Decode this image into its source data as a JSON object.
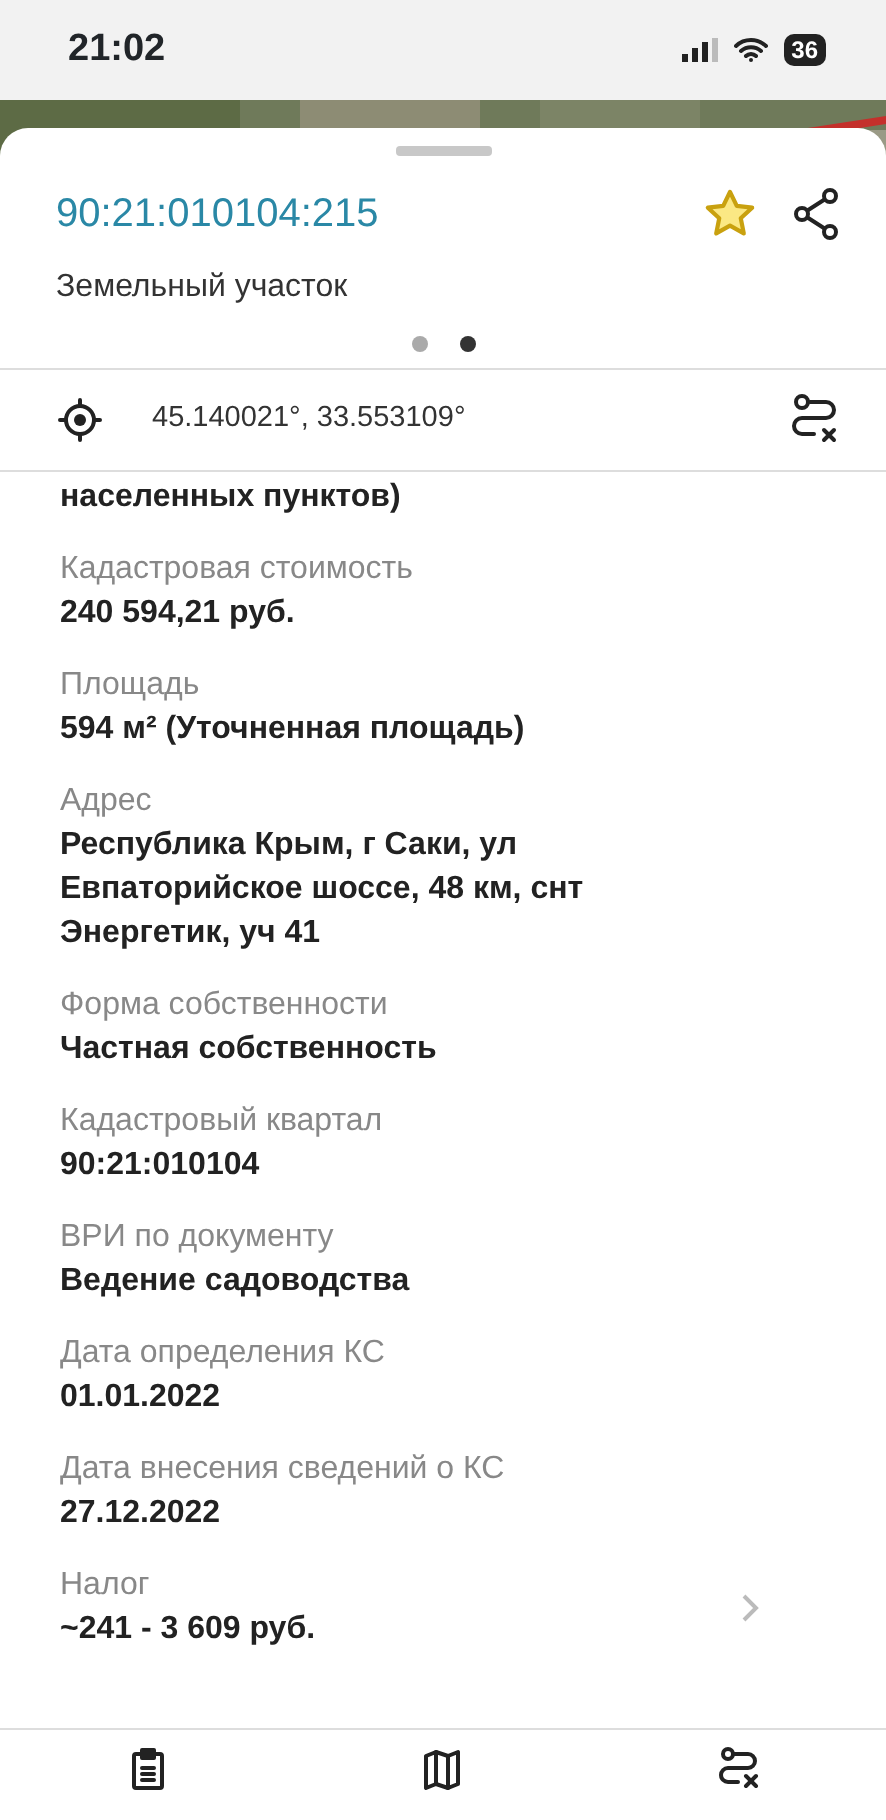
{
  "status_bar": {
    "time": "21:02",
    "battery": "36"
  },
  "sheet": {
    "title": "90:21:010104:215",
    "favorite": true,
    "subtitle": "Земельный участок",
    "pages": [
      {
        "selected": false
      },
      {
        "selected": true
      }
    ],
    "coordinates": "45.140021°, 33.553109°"
  },
  "fields": [
    {
      "value": "населенных пунктов)",
      "link": false
    },
    {
      "label": "Кадастровая стоимость",
      "value": "240 594,21 руб.",
      "link": false
    },
    {
      "label": "Площадь",
      "value": "594 м² (Уточненная площадь)",
      "link": false
    },
    {
      "label": "Адрес",
      "value": "Республика Крым, г Саки, ул Евпаторийское шоссе, 48 км, снт Энергетик, уч 41",
      "link": false
    },
    {
      "label": "Форма собственности",
      "value": "Частная собственность",
      "link": false
    },
    {
      "label": "Кадастровый квартал",
      "value": "90:21:010104",
      "link": false
    },
    {
      "label": "ВРИ по документу",
      "value": "Ведение садоводства",
      "link": false
    },
    {
      "label": "Дата определения КС",
      "value": "01.01.2022",
      "link": false
    },
    {
      "label": "Дата внесения сведений о КС",
      "value": "27.12.2022",
      "link": false
    },
    {
      "label": "Налог",
      "value": "~241 - 3 609 руб.",
      "link": true
    }
  ],
  "tab_bar": [
    {
      "kind": "clipboard"
    },
    {
      "kind": "map"
    },
    {
      "kind": "route"
    }
  ]
}
